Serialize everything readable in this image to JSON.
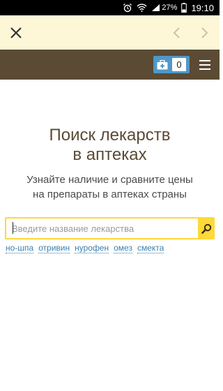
{
  "status_bar": {
    "battery": "27%",
    "time": "19:10"
  },
  "hero": {
    "title_line1": "Поиск лекарств",
    "title_line2": "в аптеках",
    "subtitle_line1": "Узнайте наличие и сравните цены",
    "subtitle_line2": "на препараты в аптеках страны"
  },
  "header": {
    "kit_count": "0"
  },
  "search": {
    "placeholder": "Введите название лекарства"
  },
  "suggestions": [
    "но-шпа",
    "отривин",
    "нурофен",
    "омез",
    "смекта"
  ],
  "colors": {
    "header": "#5b4a34",
    "browser_bar": "#fdf7d7",
    "accent_yellow": "#ffd83a",
    "kit_blue": "#4f98c8",
    "link": "#3b7fae"
  }
}
